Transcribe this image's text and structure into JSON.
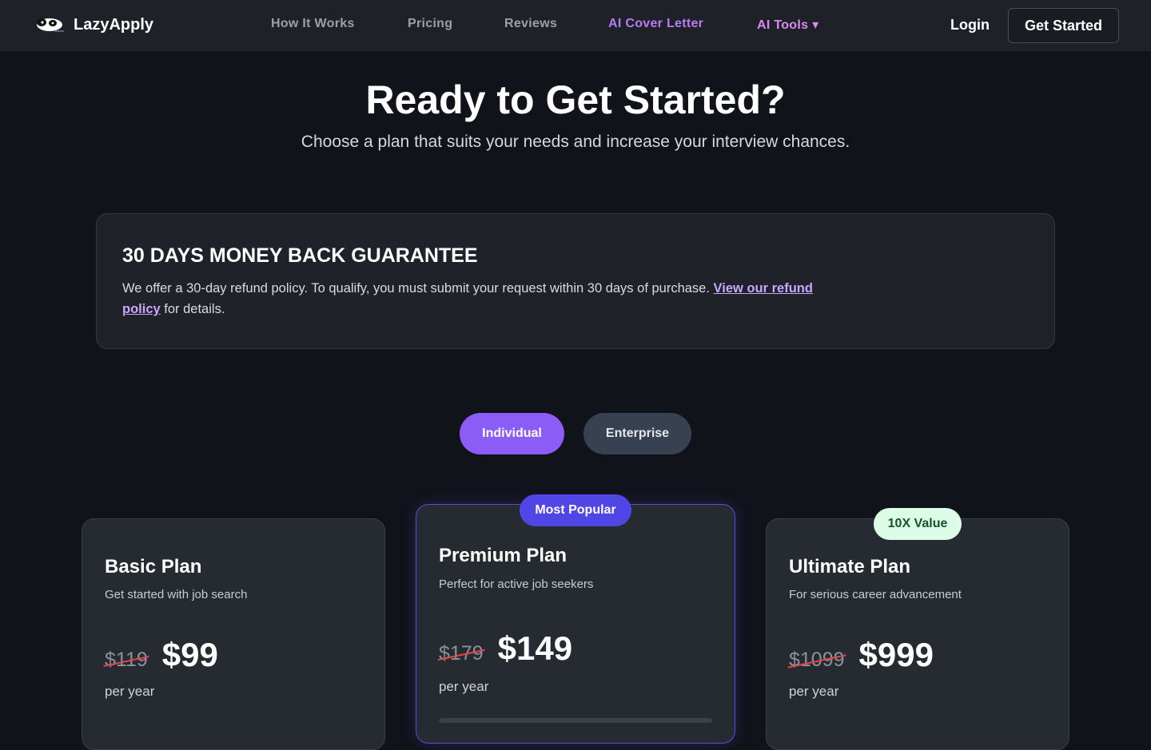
{
  "nav": {
    "brand": "LazyApply",
    "links": [
      "How It Works",
      "Pricing",
      "Reviews",
      "AI Cover Letter",
      "AI Tools ▾"
    ],
    "login": "Login",
    "cta": "Get Started"
  },
  "hero": {
    "title": "Ready to Get Started?",
    "subtitle": "Choose a plan that suits your needs and increase your interview chances."
  },
  "guarantee": {
    "title": "30 DAYS MONEY BACK GUARANTEE",
    "text": "We offer a 30-day refund policy. To qualify, you must submit your request within 30 days of purchase.",
    "link": "View our refund policy",
    "suffix": "for details."
  },
  "toggle": {
    "individual": "Individual",
    "enterprise": "Enterprise",
    "active": "Individual"
  },
  "plans": [
    {
      "name": "Basic Plan",
      "desc": "Get started with job search",
      "old_price": "$119",
      "price": "$99",
      "period": "per year"
    },
    {
      "name": "Premium Plan",
      "desc": "Perfect for active job seekers",
      "old_price": "$179",
      "price": "$149",
      "period": "per year",
      "badge": "Most Popular"
    },
    {
      "name": "Ultimate Plan",
      "desc": "For serious career advancement",
      "old_price": "$1099",
      "price": "$999",
      "period": "per year",
      "badge": "10X Value"
    }
  ],
  "colors": {
    "background": "#10131a",
    "nav": "#1f2129",
    "accent_purple": "#8b5cf6",
    "popular_badge": "#4f46e5",
    "value_badge": "#dcfce7",
    "strike": "#e04848"
  },
  "icons": {
    "logo": "panda-logo-icon"
  }
}
